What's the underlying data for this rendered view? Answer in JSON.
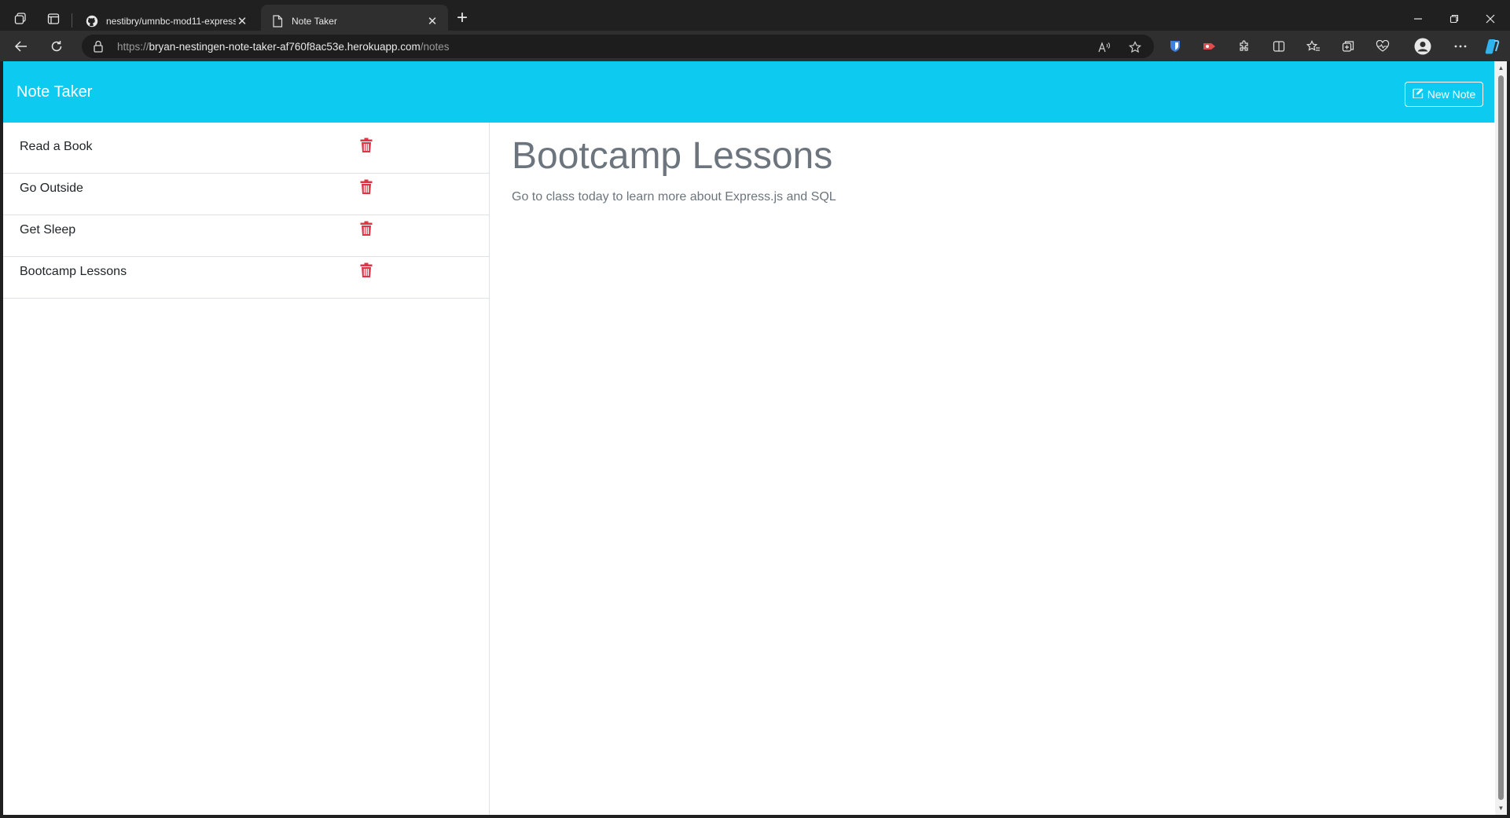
{
  "browser": {
    "tabs": [
      {
        "title": "nestibry/umnbc-mod11-express.js",
        "active": false,
        "icon": "github-icon"
      },
      {
        "title": "Note Taker",
        "active": true,
        "icon": "page-icon"
      }
    ],
    "address": {
      "scheme": "https://",
      "host": "bryan-nestingen-note-taker-af760f8ac53e.herokuapp.com",
      "path": "/notes"
    }
  },
  "app": {
    "brand": "Note Taker",
    "new_note_label": "New Note",
    "notes": [
      {
        "title": "Read a Book"
      },
      {
        "title": "Go Outside"
      },
      {
        "title": "Get Sleep"
      },
      {
        "title": "Bootcamp Lessons"
      }
    ],
    "active_note": {
      "title": "Bootcamp Lessons",
      "text": "Go to class today to learn more about Express.js and SQL"
    }
  },
  "colors": {
    "navbar": "#0dcaf0",
    "delete": "#dc3545",
    "muted_text": "#6c757d"
  }
}
